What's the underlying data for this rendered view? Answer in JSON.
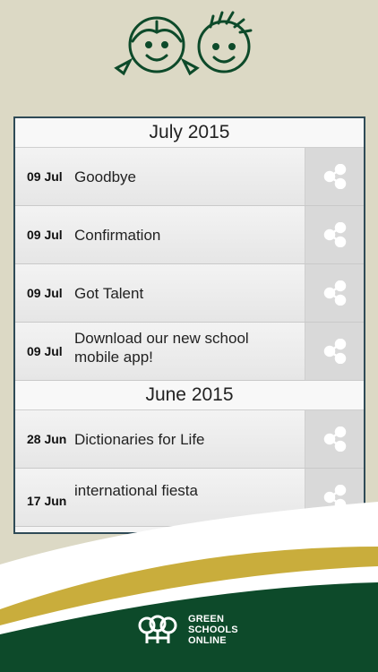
{
  "sections": [
    {
      "title": "July 2015",
      "items": [
        {
          "date": "09 Jul",
          "title": "Goodbye"
        },
        {
          "date": "09 Jul",
          "title": "Confirmation"
        },
        {
          "date": "09 Jul",
          "title": "Got Talent"
        },
        {
          "date": "09 Jul",
          "title": "Download our new school mobile app!"
        }
      ]
    },
    {
      "title": "June 2015",
      "items": [
        {
          "date": "28 Jun",
          "title": "Dictionaries for Life"
        },
        {
          "date": "17 Jun",
          "title": "international fiesta"
        }
      ]
    }
  ],
  "brand": {
    "line1": "GREEN",
    "line2": "SCHOOLS",
    "line3": "ONLINE"
  },
  "colors": {
    "background": "#dcd9c5",
    "brand_green": "#0d4a2a",
    "brand_gold": "#c9ad3c",
    "icon_white": "#ffffff"
  },
  "icons": {
    "share": "share-icon",
    "mascot": "kids-mascot-icon",
    "logo": "green-schools-logo-icon"
  }
}
